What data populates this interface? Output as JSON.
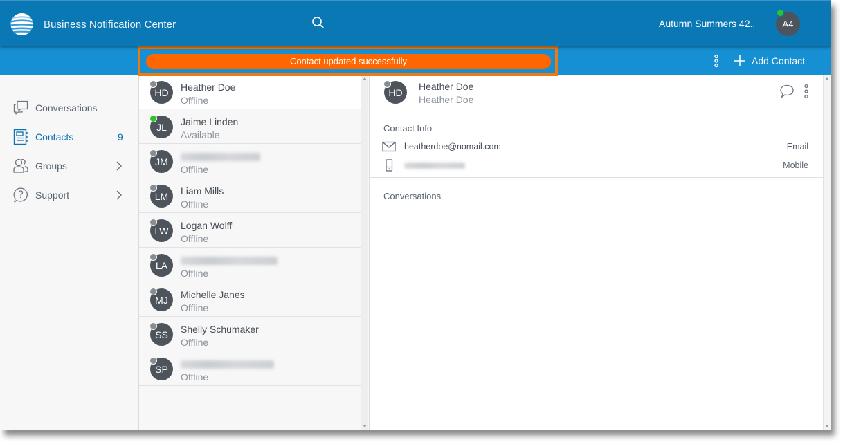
{
  "header": {
    "app_title": "Business Notification Center",
    "logo_icon": "att-globe-icon",
    "search_icon": "search-icon",
    "user_name": "Autumn Summers 42...",
    "user_initials": "A4",
    "user_presence": "available",
    "colors": {
      "header_bg": "#0a78b4",
      "subbar_bg": "#1690d2",
      "toast_bg": "#ff6600",
      "highlight": "#ee7a12"
    }
  },
  "toolbar": {
    "toast_message": "Contact updated successfully",
    "more_icon": "more-vertical-icon",
    "add_contact_label": "Add Contact",
    "add_icon": "plus-icon"
  },
  "sidebar": {
    "items": [
      {
        "label": "Conversations",
        "icon": "conversations-icon",
        "active": false
      },
      {
        "label": "Contacts",
        "icon": "contacts-book-icon",
        "active": true,
        "badge": "9"
      },
      {
        "label": "Groups",
        "icon": "groups-icon",
        "active": false,
        "chevron": true
      },
      {
        "label": "Support",
        "icon": "help-icon",
        "active": false,
        "chevron": true
      }
    ]
  },
  "contacts": [
    {
      "initials": "HD",
      "name": "Heather Doe",
      "status": "Offline",
      "presence": "offline",
      "selected": true,
      "redacted": false
    },
    {
      "initials": "JL",
      "name": "Jaime Linden",
      "status": "Available",
      "presence": "available",
      "selected": false,
      "redacted": false
    },
    {
      "initials": "JM",
      "name": "",
      "status": "Offline",
      "presence": "offline",
      "selected": false,
      "redacted": true
    },
    {
      "initials": "LM",
      "name": "Liam Mills",
      "status": "Offline",
      "presence": "offline",
      "selected": false,
      "redacted": false
    },
    {
      "initials": "LW",
      "name": "Logan Wolff",
      "status": "Offline",
      "presence": "offline",
      "selected": false,
      "redacted": false
    },
    {
      "initials": "LA",
      "name": "",
      "status": "Offline",
      "presence": "offline",
      "selected": false,
      "redacted": true
    },
    {
      "initials": "MJ",
      "name": "Michelle Janes",
      "status": "Offline",
      "presence": "offline",
      "selected": false,
      "redacted": false
    },
    {
      "initials": "SS",
      "name": "Shelly Schumaker",
      "status": "Offline",
      "presence": "offline",
      "selected": false,
      "redacted": false
    },
    {
      "initials": "SP",
      "name": "",
      "status": "Offline",
      "presence": "offline",
      "selected": false,
      "redacted": true
    }
  ],
  "detail": {
    "initials": "HD",
    "name": "Heather Doe",
    "subtitle": "Heather Doe",
    "presence": "offline",
    "chat_icon": "chat-bubble-icon",
    "more_icon": "more-vertical-icon",
    "contact_info_title": "Contact Info",
    "contact_info": [
      {
        "icon": "mail-icon",
        "value": "heatherdoe@nomail.com",
        "type": "Email",
        "redacted": false
      },
      {
        "icon": "mobile-phone-icon",
        "value": "",
        "type": "Mobile",
        "redacted": true
      }
    ],
    "conversations_title": "Conversations"
  }
}
